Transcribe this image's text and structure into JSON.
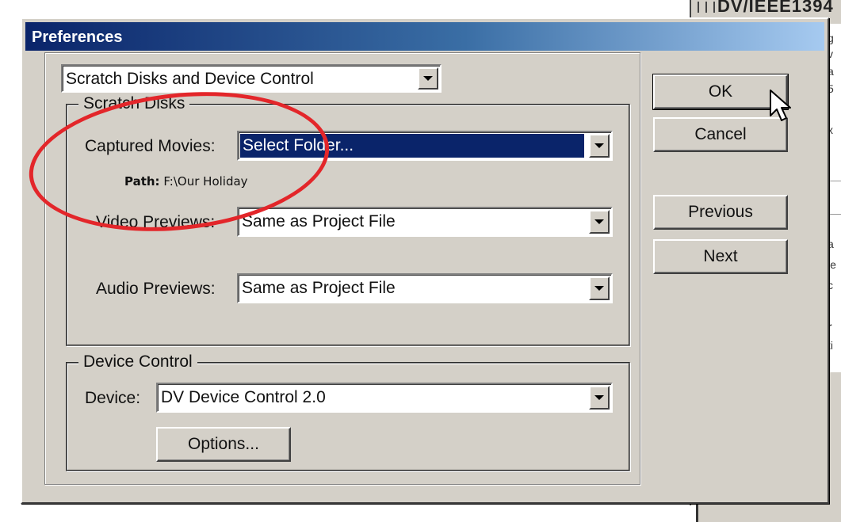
{
  "background": {
    "title_fragment": "DV/IEEE1394",
    "edge_letters": [
      "g",
      "v",
      "a",
      "5",
      "x",
      "a",
      "le",
      "c",
      "r",
      "ti"
    ]
  },
  "dialog": {
    "title": "Preferences",
    "category_select": {
      "value": "Scratch Disks and Device Control"
    }
  },
  "scratch_disks": {
    "group_label": "Scratch Disks",
    "captured_movies": {
      "label": "Captured Movies:",
      "value": "Select Folder..."
    },
    "path": {
      "label": "Path:",
      "value": "F:\\Our Holiday"
    },
    "video_previews": {
      "label": "Video Previews:",
      "value": "Same as Project File"
    },
    "audio_previews": {
      "label": "Audio Previews:",
      "value": "Same as Project File"
    }
  },
  "device_control": {
    "group_label": "Device Control",
    "device": {
      "label": "Device:",
      "value": "DV Device Control 2.0"
    },
    "options_label": "Options..."
  },
  "buttons": {
    "ok": "OK",
    "cancel": "Cancel",
    "previous": "Previous",
    "next": "Next"
  },
  "colors": {
    "selection": "#0a246a",
    "annotation": "#e3262a",
    "face": "#d4d0c8"
  }
}
